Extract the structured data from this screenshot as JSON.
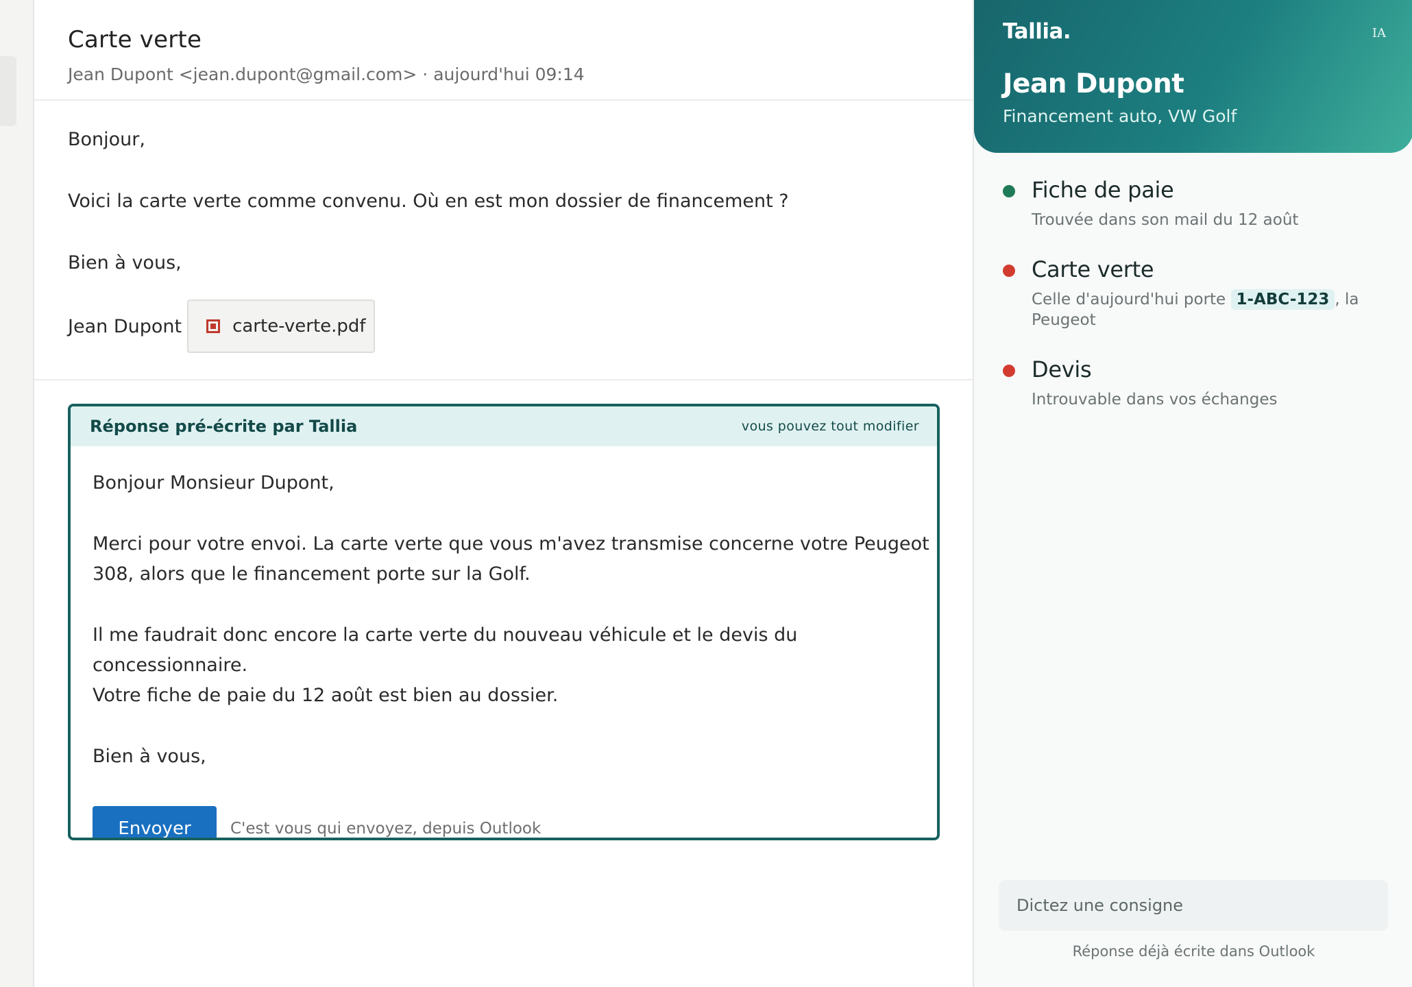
{
  "mail": {
    "subject": "Carte verte",
    "sender_line": "Jean Dupont <jean.dupont@gmail.com> · aujourd'hui 09:14",
    "body": {
      "greeting": "Bonjour,",
      "message": "Voici la carte verte comme convenu. Où en est mon dossier de financement ?",
      "closing": "Bien à vous,",
      "signature": "Jean Dupont"
    },
    "attachment": {
      "filename": "carte-verte.pdf",
      "icon": "pdf-file-icon"
    }
  },
  "reply": {
    "title": "Réponse pré-écrite par Tallia",
    "hint": "vous pouvez tout modifier",
    "greeting": "Bonjour Monsieur Dupont,",
    "paragraph1_line1": "Merci pour votre envoi. La carte verte que vous m'avez transmise concerne votre Peugeot",
    "paragraph1_line2": "308, alors que le financement porte sur la Golf.",
    "paragraph2_line1": "Il me faudrait donc encore la carte verte du nouveau véhicule et le devis du concessionnaire.",
    "paragraph2_line2": "Votre fiche de paie du 12 août est bien au dossier.",
    "closing": "Bien à vous,",
    "send_label": "Envoyer",
    "send_note": "C'est vous qui envoyez, depuis Outlook"
  },
  "panel": {
    "brand": "Tallia.",
    "badge": "IA",
    "client_name": "Jean Dupont",
    "client_subtitle": "Financement auto, VW Golf",
    "checklist": [
      {
        "title": "Fiche de paie",
        "status": "found",
        "status_color": "#1e7a57",
        "description": "Trouvée dans son mail du 12 août"
      },
      {
        "title": "Carte verte",
        "status": "problem",
        "status_color": "#d23b30",
        "description_before": "Celle d'aujourd'hui porte ",
        "plate": "1-ABC-123",
        "description_after": ", la Peugeot"
      },
      {
        "title": "Devis",
        "status": "missing",
        "status_color": "#d23b30",
        "description": "Introuvable dans vos échanges"
      }
    ],
    "dictate_placeholder": "Dictez une consigne",
    "footer_note": "Réponse déjà écrite dans Outlook"
  },
  "colors": {
    "accent_teal": "#17615f",
    "send_blue": "#1a70c0",
    "ok_green": "#1e7a57",
    "alert_red": "#d23b30"
  }
}
